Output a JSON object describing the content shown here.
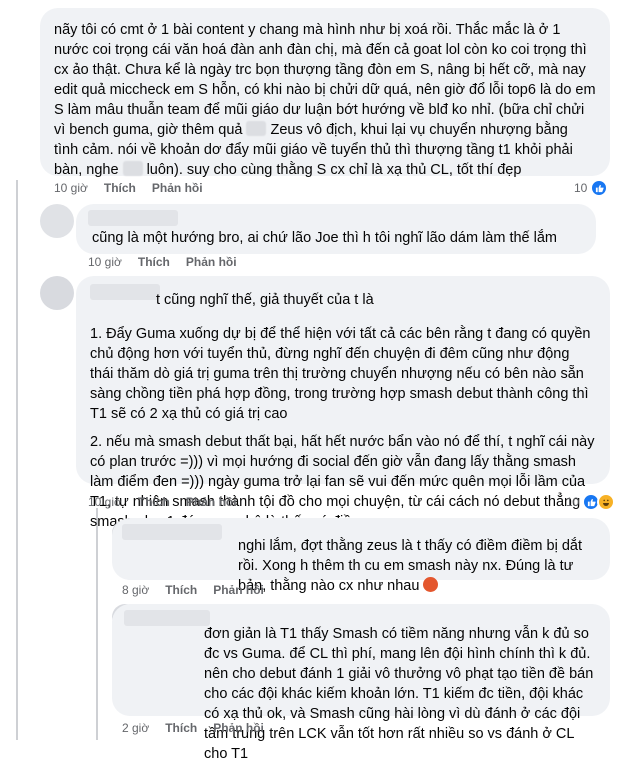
{
  "labels": {
    "like": "Thích",
    "reply": "Phản hồi"
  },
  "comments": [
    {
      "text": "nãy tôi có cmt ở 1 bài content y chang mà hình như bị xoá rồi. Thắc mắc là ở 1 nước coi trọng cái văn hoá đàn anh đàn chị, mà đến cả goat lol còn ko coi trọng thì cx ảo thật. Chưa kể là ngày trc bọn thượng tầng đòn em S, nâng bị hết cỡ, mà nay edit quả miccheck em S hỗn, có khi nào bị chửi dữ quá, nên giờ đổ lỗi top6 là do em S làm mâu thuẫn team để mũi giáo dư luận bớt hướng về blđ ko nhỉ. (bữa chỉ chửi vì bench guma, giờ thêm quả",
      "text_b": "Zeus vô địch, khui lại vụ chuyển nhượng bằng tình cảm. nói về khoản dơ đẩy mũi giáo về tuyển thủ thì thượng tầng t1 khỏi phải bàn, nghe",
      "text_c": "luôn). suy cho cùng thằng S cx chỉ là xạ thủ CL, tốt thí đẹp",
      "time": "10 giờ",
      "reactions": "10"
    },
    {
      "text": "cũng là một hướng bro, ai chứ lão Joe thì h tôi nghĩ lão dám làm thế lắm",
      "time": "10 giờ"
    },
    {
      "text_head": "t cũng nghĩ thế, giả thuyết của t là",
      "para1": "1. Đẩy Guma xuống dự bị để thể hiện với tất cả các bên rằng t đang có quyền chủ động hơn với tuyển thủ, đừng nghĩ đến chuyện đi đêm cũng như động thái thăm dò giá trị guma trên thị trường chuyển nhượng nếu có bên nào sẵn sàng chồng tiền phá hợp đồng, trong trường hợp smash debut thành công thì T1 sẽ có 2 xạ thủ có giá trị cao",
      "para2": "2. nếu mà smash debut thất bại, hất hết nước bẩn vào nó để thí, t nghĩ cái này có plan trước =))) vì mọi hướng đi social đến giờ vẫn đang lấy thằng smash làm điểm đen =))) ngày guma trở lại fan sẽ vui đến mức quên mọi lỗi lầm của T1, tự nhiên smash thành tội đồ cho mọi chuyện, từ cái cách nó debut thẳng smash như 1 đứa cưa ghê là thấy có điềm r",
      "time": "10 giờ",
      "reactions": "10"
    },
    {
      "text": "nghi lắm, đợt thằng zeus là t thấy có điềm điềm bị dắt rồi. Xong h thêm th cu em smash này nx. Đúng là tư bản, thằng nào cx như nhau",
      "time": "8 giờ"
    },
    {
      "text": "đơn giản là T1 thấy Smash có tiềm năng nhưng vẫn k đủ so đc vs Guma. để CL thì phí, mang lên đội hình chính thì k đủ. nên cho debut đánh 1 giải vô thưởng vô phạt tạo tiền đề bán cho các đội khác kiếm khoản lớn. T1 kiếm đc tiền, đội khác có xạ thủ ok, và Smash cũng hài lòng vì dù đánh ở các đội tầm trung trên LCK vẫn tốt hơn rất nhiều so vs đánh ở CL cho T1",
      "time": "2 giờ"
    }
  ]
}
